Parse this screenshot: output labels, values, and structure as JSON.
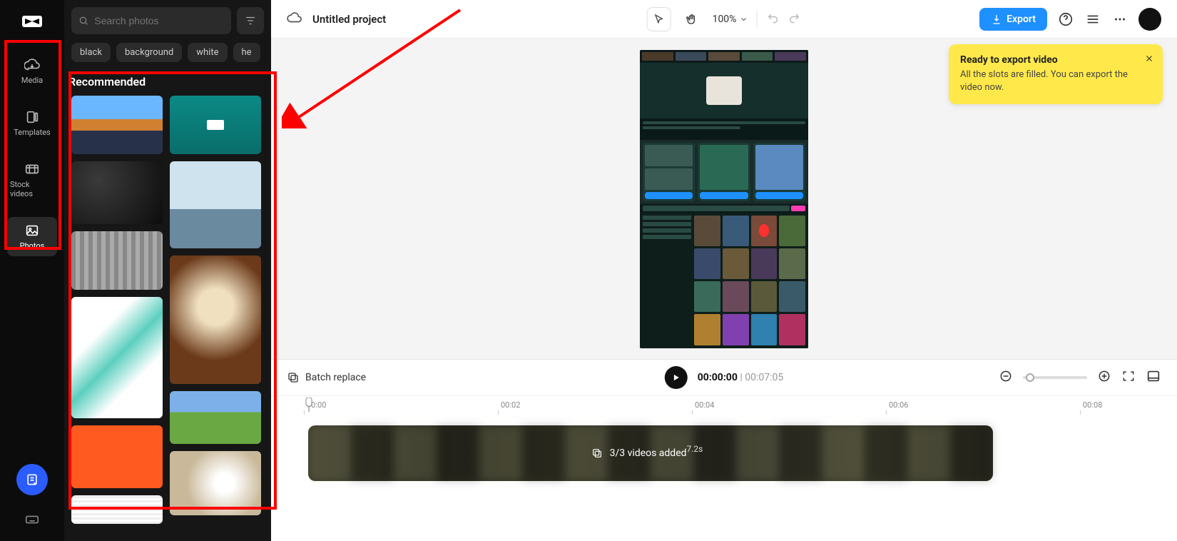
{
  "app": {
    "logo_alt": "CapCut"
  },
  "rail": {
    "items": [
      {
        "label": "Media"
      },
      {
        "label": "Templates"
      },
      {
        "label": "Stock videos"
      },
      {
        "label": "Photos"
      }
    ],
    "active_index": 3
  },
  "photos_panel": {
    "search_placeholder": "Search photos",
    "chips": [
      "black",
      "background",
      "white",
      "he"
    ],
    "section_title": "Recommended"
  },
  "topbar": {
    "project_title": "Untitled project",
    "zoom": "100%",
    "export_label": "Export"
  },
  "toast": {
    "title": "Ready to export video",
    "body": "All the slots are filled. You can export the video now."
  },
  "timeline": {
    "batch_replace_label": "Batch replace",
    "current_time": "00:00:00",
    "duration": "00:07:05",
    "ticks": [
      "00:00",
      "00:02",
      "00:04",
      "00:06",
      "00:08"
    ],
    "clip_label": "3/3 videos added",
    "clip_duration": "7.2s"
  }
}
